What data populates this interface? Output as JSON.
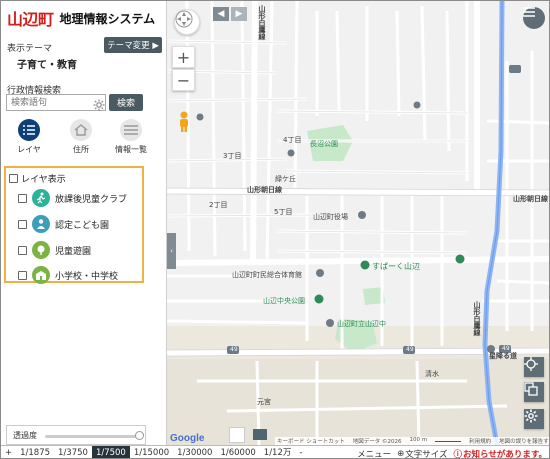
{
  "app": {
    "town": "山辺町",
    "system": "地理情報システム"
  },
  "theme": {
    "label": "表示テーマ",
    "change_button": "テーマ変更 ▶",
    "value": "子育て・教育"
  },
  "search": {
    "label": "行政情報検索",
    "placeholder": "検索語句",
    "button": "検索"
  },
  "tools": [
    {
      "label": "レイヤ",
      "icon": "list-icon"
    },
    {
      "label": "住所",
      "icon": "house-icon"
    },
    {
      "label": "情報一覧",
      "icon": "menu-icon"
    }
  ],
  "layers": {
    "header": "レイヤ表示",
    "items": [
      {
        "label": "放課後児童クラブ",
        "color": "#2bb39a",
        "icon": "running-child-icon"
      },
      {
        "label": "認定こども園",
        "color": "#3c9fb8",
        "icon": "child-icon"
      },
      {
        "label": "児童遊園",
        "color": "#7cb342",
        "icon": "tree-icon"
      },
      {
        "label": "小学校・中学校",
        "color": "#7cb342",
        "icon": "school-icon"
      }
    ]
  },
  "transparency": {
    "label": "透過度",
    "value": 1.0
  },
  "map": {
    "labels": {
      "mono": "4丁目",
      "ch3": "3丁目",
      "ch2": "2丁目",
      "ch5": "5丁目",
      "park_nagamiya": "長沼公園",
      "midorigaoka": "緑ケ丘",
      "asahi_line": "山形朝日線",
      "asahi_line2": "山形朝日線",
      "town_office": "山辺町役場",
      "gym": "山辺町町民総合体育館",
      "supermarket": "すぱーく山辺",
      "central_park": "山辺中央公園",
      "jhs": "山辺町立山辺中",
      "route49a": "49",
      "route49b": "49",
      "route49c": "49",
      "hoshigara": "星降る道",
      "shimizu": "清水",
      "motomiya": "元宮",
      "shiroshi": "山形白鷹線",
      "north_route": "山形白鷹線"
    },
    "attribution": {
      "google": "Google",
      "shortcuts": "キーボード ショートカット",
      "data": "地図データ ©2026",
      "scale": "100 m",
      "terms": "利用規約",
      "report": "地図の誤りを報告する"
    }
  },
  "scales": [
    "1/1875",
    "1/3750",
    "1/7500",
    "1/15000",
    "1/30000",
    "1/60000",
    "1/12万"
  ],
  "active_scale": "1/7500",
  "footer": {
    "prev": "+",
    "next": "-",
    "menu": "メニュー",
    "text_size": "文字サイズ",
    "notice": "お知らせがあります。"
  }
}
